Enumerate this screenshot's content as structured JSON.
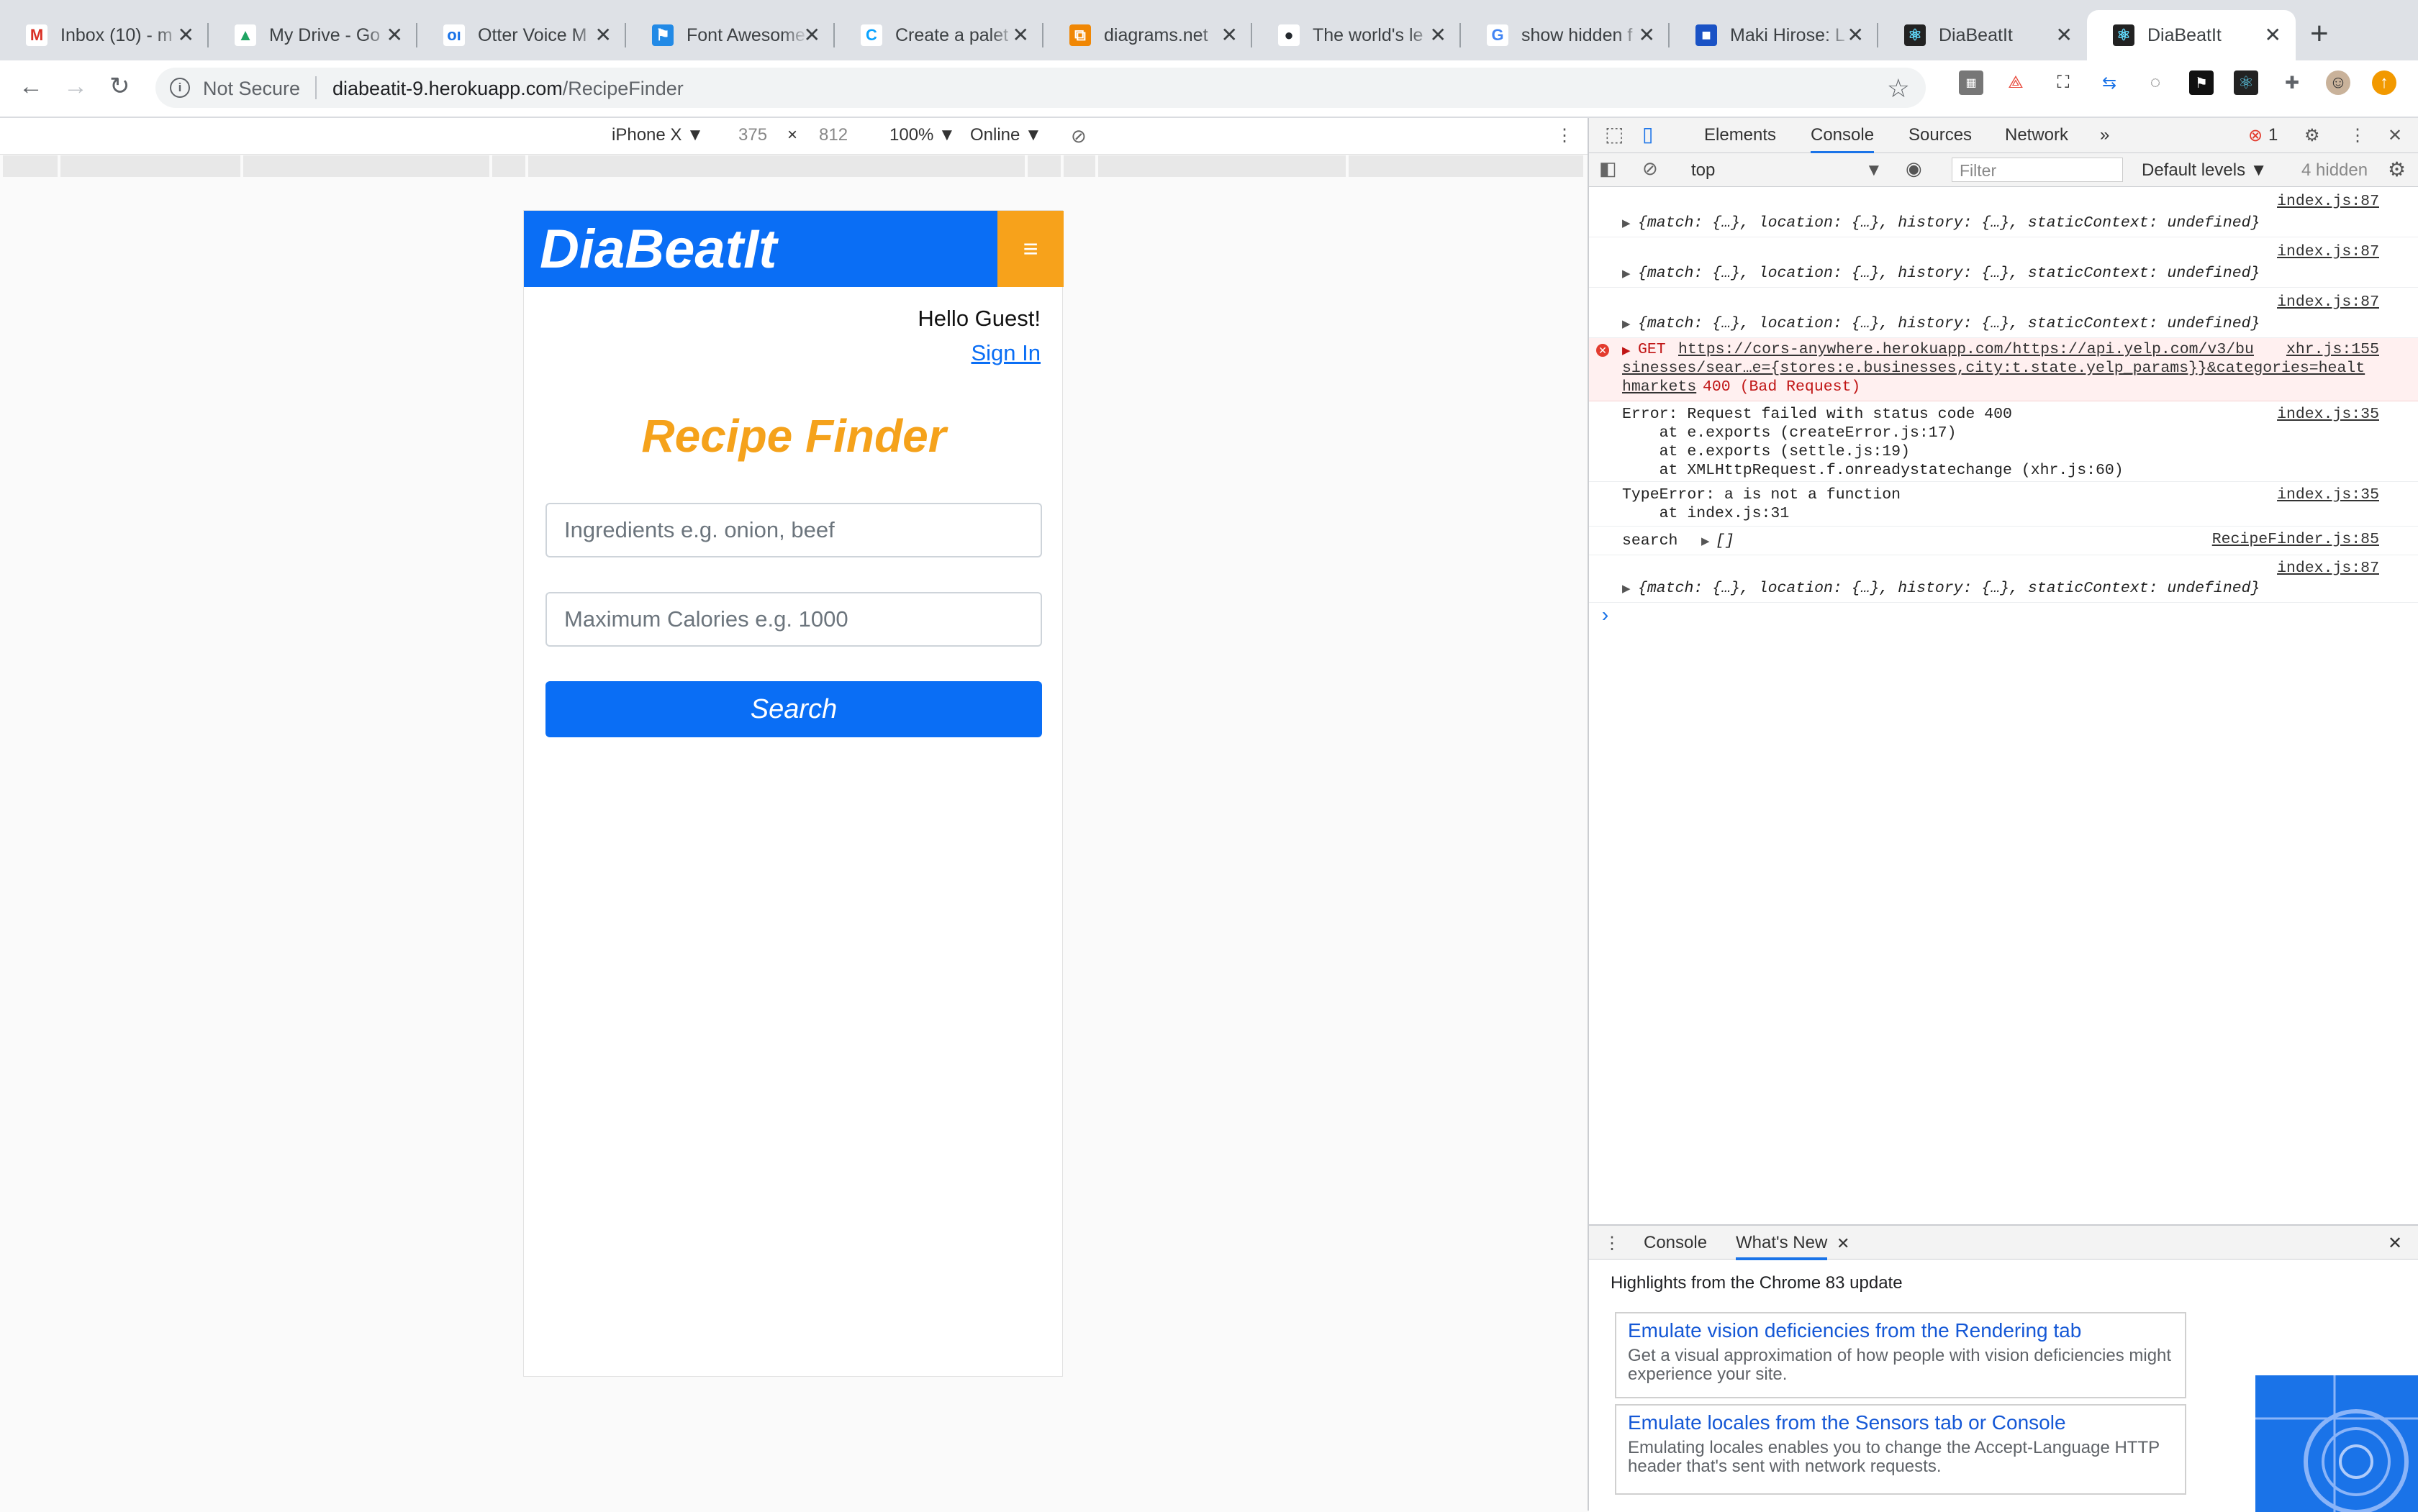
{
  "browser": {
    "tabs": [
      {
        "title": "Inbox (10) - m",
        "icon": "gmail-icon",
        "glyph": "M",
        "icon_color": "#d93025",
        "icon_bg": "#ffffff"
      },
      {
        "title": "My Drive - Go",
        "icon": "google-drive-icon",
        "glyph": "▲",
        "icon_color": "#1fa463",
        "icon_bg": "#ffffff"
      },
      {
        "title": "Otter Voice M",
        "icon": "otter-icon",
        "glyph": "oı",
        "icon_color": "#1a73e8",
        "icon_bg": "#ffffff"
      },
      {
        "title": "Font Awesome",
        "icon": "flag-icon",
        "glyph": "⚑",
        "icon_color": "#ffffff",
        "icon_bg": "#228ae6"
      },
      {
        "title": "Create a palet",
        "icon": "coolors-icon",
        "glyph": "C",
        "icon_color": "#0aa3ff",
        "icon_bg": "#ffffff"
      },
      {
        "title": "diagrams.net",
        "icon": "diagrams-icon",
        "glyph": "⧉",
        "icon_color": "#ffffff",
        "icon_bg": "#f08705"
      },
      {
        "title": "The world's le",
        "icon": "github-icon",
        "glyph": "●",
        "icon_color": "#24292e",
        "icon_bg": "#ffffff"
      },
      {
        "title": "show hidden f",
        "icon": "google-icon",
        "glyph": "G",
        "icon_color": "#4285f4",
        "icon_bg": "#ffffff"
      },
      {
        "title": "Maki Hirose: L",
        "icon": "linkedin-icon",
        "glyph": "■",
        "icon_color": "#ffffff",
        "icon_bg": "#1a52c5"
      },
      {
        "title": "DiaBeatIt",
        "icon": "react-icon",
        "glyph": "⚛",
        "icon_color": "#61dafb",
        "icon_bg": "#222222"
      },
      {
        "title": "DiaBeatIt",
        "icon": "react-icon",
        "glyph": "⚛",
        "icon_color": "#61dafb",
        "icon_bg": "#222222",
        "active": true
      }
    ],
    "not_secure": "Not Secure",
    "url_host": "diabeatit-9.herokuapp.com",
    "url_path": "/RecipeFinder"
  },
  "device_toolbar": {
    "device": "iPhone X ▼",
    "width": "375",
    "times": "×",
    "height": "812",
    "zoom": "100% ▼",
    "network": "Online ▼"
  },
  "app": {
    "brand": "DiaBeatIt",
    "menu_icon": "≡",
    "greeting": "Hello Guest!",
    "sign_in": "Sign In",
    "page_title": "Recipe Finder",
    "ingredients_placeholder": "Ingredients e.g. onion, beef",
    "calories_placeholder": "Maximum Calories e.g. 1000",
    "search_label": "Search",
    "colors": {
      "primary": "#0a6ef5",
      "accent": "#f7a21b"
    }
  },
  "devtools": {
    "tabs": [
      "Elements",
      "Console",
      "Sources",
      "Network",
      "»"
    ],
    "active_tab": "Console",
    "error_count": "1",
    "context": "top",
    "filter_placeholder": "Filter",
    "levels": "Default levels ▼",
    "hidden": "4 hidden",
    "console": [
      {
        "type": "log",
        "src": "index.js:87",
        "msg": "{match: {…}, location: {…}, history: {…}, staticContext: undefined}"
      },
      {
        "type": "log",
        "src": "index.js:87",
        "msg": "{match: {…}, location: {…}, history: {…}, staticContext: undefined}"
      },
      {
        "type": "log",
        "src": "index.js:87",
        "msg": "{match: {…}, location: {…}, history: {…}, staticContext: undefined}"
      },
      {
        "type": "error",
        "src": "xhr.js:155",
        "method": "GET",
        "line1": "https://cors-anywhere.herokuapp.com/https://api.yelp.com/v3/bu",
        "line2": "sinesses/sear…e={stores:e.businesses,city:t.state.yelp_params}}&categories=healt",
        "line3": "hmarkets",
        "status": "400 (Bad Request)"
      },
      {
        "type": "plain",
        "src": "index.js:35",
        "lines": [
          "Error: Request failed with status code 400",
          "    at e.exports (createError.js:17)",
          "    at e.exports (settle.js:19)",
          "    at XMLHttpRequest.f.onreadystatechange (xhr.js:60)"
        ]
      },
      {
        "type": "plain",
        "src": "index.js:35",
        "lines": [
          "TypeError: a is not a function",
          "    at index.js:31"
        ]
      },
      {
        "type": "search",
        "src": "RecipeFinder.js:85",
        "label": "search",
        "value": "[]"
      },
      {
        "type": "log",
        "src": "index.js:87",
        "msg": "{match: {…}, location: {…}, history: {…}, staticContext: undefined}"
      }
    ],
    "prompt": "›",
    "drawer": {
      "tabs": [
        "Console",
        "What's New"
      ],
      "active": "What's New",
      "highlights": "Highlights from the Chrome 83 update",
      "cards": [
        {
          "title": "Emulate vision deficiencies from the Rendering tab",
          "desc": "Get a visual approximation of how people with vision deficiencies might experience your site."
        },
        {
          "title": "Emulate locales from the Sensors tab or Console",
          "desc": "Emulating locales enables you to change the Accept-Language HTTP header that's sent with network requests."
        }
      ]
    }
  }
}
